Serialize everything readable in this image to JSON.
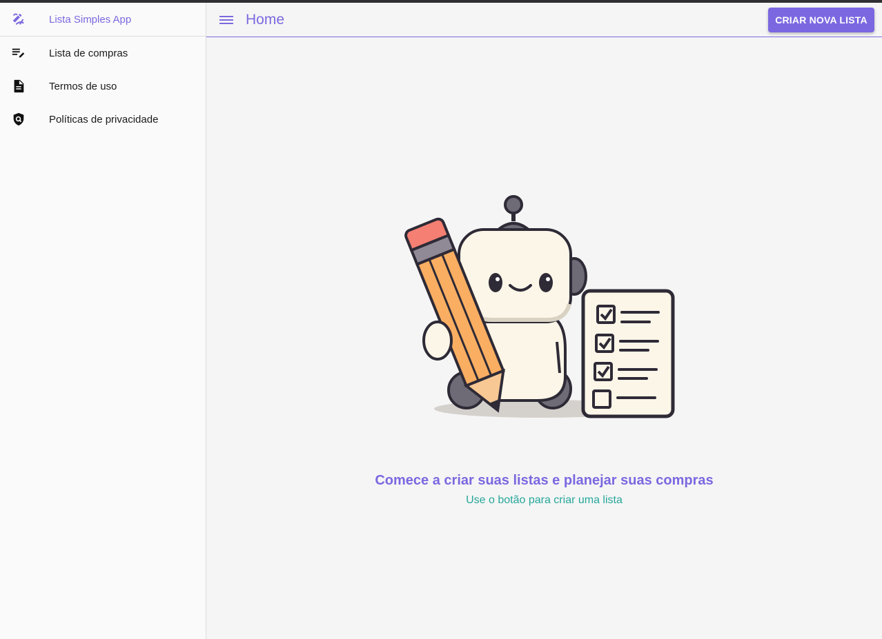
{
  "app": {
    "name": "Lista Simples App",
    "accent_color": "#7b68e0",
    "secondary_color": "#26a69a"
  },
  "sidebar": {
    "header": {
      "label": "Lista Simples App",
      "icon": "app-logo-pencil-icon"
    },
    "items": [
      {
        "label": "Lista de compras",
        "icon": "playlist-edit-icon"
      },
      {
        "label": "Termos de uso",
        "icon": "document-icon"
      },
      {
        "label": "Políticas de privacidade",
        "icon": "shield-search-icon"
      }
    ]
  },
  "appbar": {
    "menu_icon": "menu-icon",
    "title": "Home",
    "create_button_label": "CRIAR NOVA LISTA"
  },
  "empty_state": {
    "illustration": "robot-with-pencil-and-checklist",
    "title": "Comece a criar suas listas e planejar suas compras",
    "subtitle": "Use o botão para criar uma lista"
  }
}
